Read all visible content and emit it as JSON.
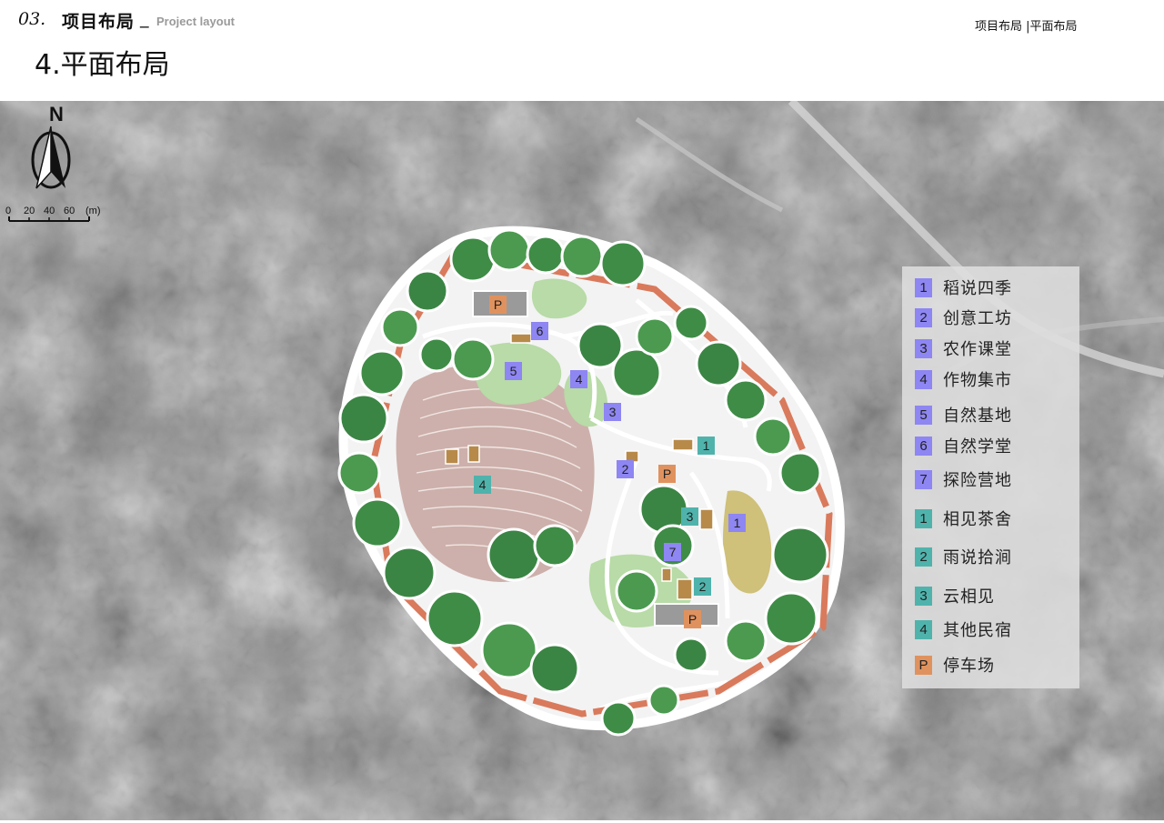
{
  "header": {
    "section_number": "03.",
    "section_title": "项目布局",
    "separator": "_",
    "section_title_en": "Project layout",
    "breadcrumb": "项目布局 |平面布局",
    "page_title": "4.平面布局"
  },
  "compass": {
    "north_label": "N"
  },
  "scale_bar": {
    "ticks": [
      "0",
      "20",
      "40",
      "60"
    ],
    "unit": "(m)"
  },
  "colors": {
    "purple_badge": "#8e86f2",
    "teal_badge": "#4fb3ac",
    "parking_badge": "#e0925e",
    "boundary": "#d97a5c",
    "tree_green": "#3e8a45",
    "light_green": "#a9d49b",
    "terrace_pink": "#c9aaa6"
  },
  "legend": {
    "items": [
      {
        "badge": "1",
        "type": "purple",
        "label": "稻说四季"
      },
      {
        "badge": "2",
        "type": "purple",
        "label": "创意工坊"
      },
      {
        "badge": "3",
        "type": "purple",
        "label": "农作课堂"
      },
      {
        "badge": "4",
        "type": "purple",
        "label": "作物集市"
      },
      {
        "badge": "5",
        "type": "purple",
        "label": "自然基地"
      },
      {
        "badge": "6",
        "type": "purple",
        "label": "自然学堂"
      },
      {
        "badge": "7",
        "type": "purple",
        "label": "探险营地"
      },
      {
        "badge": "1",
        "type": "teal",
        "label": "相见茶舍"
      },
      {
        "badge": "2",
        "type": "teal",
        "label": "雨说拾涧"
      },
      {
        "badge": "3",
        "type": "teal",
        "label": "云相见"
      },
      {
        "badge": "4",
        "type": "teal",
        "label": "其他民宿"
      },
      {
        "badge": "P",
        "type": "parking",
        "label": "停车场"
      }
    ]
  },
  "map_markers": [
    {
      "text": "P",
      "type": "parking"
    },
    {
      "text": "6",
      "type": "purple"
    },
    {
      "text": "5",
      "type": "purple"
    },
    {
      "text": "4",
      "type": "purple"
    },
    {
      "text": "3",
      "type": "purple"
    },
    {
      "text": "1",
      "type": "teal"
    },
    {
      "text": "2",
      "type": "purple"
    },
    {
      "text": "P",
      "type": "parking"
    },
    {
      "text": "4",
      "type": "teal"
    },
    {
      "text": "3",
      "type": "teal"
    },
    {
      "text": "1",
      "type": "purple"
    },
    {
      "text": "7",
      "type": "purple"
    },
    {
      "text": "2",
      "type": "teal"
    },
    {
      "text": "P",
      "type": "parking"
    }
  ]
}
